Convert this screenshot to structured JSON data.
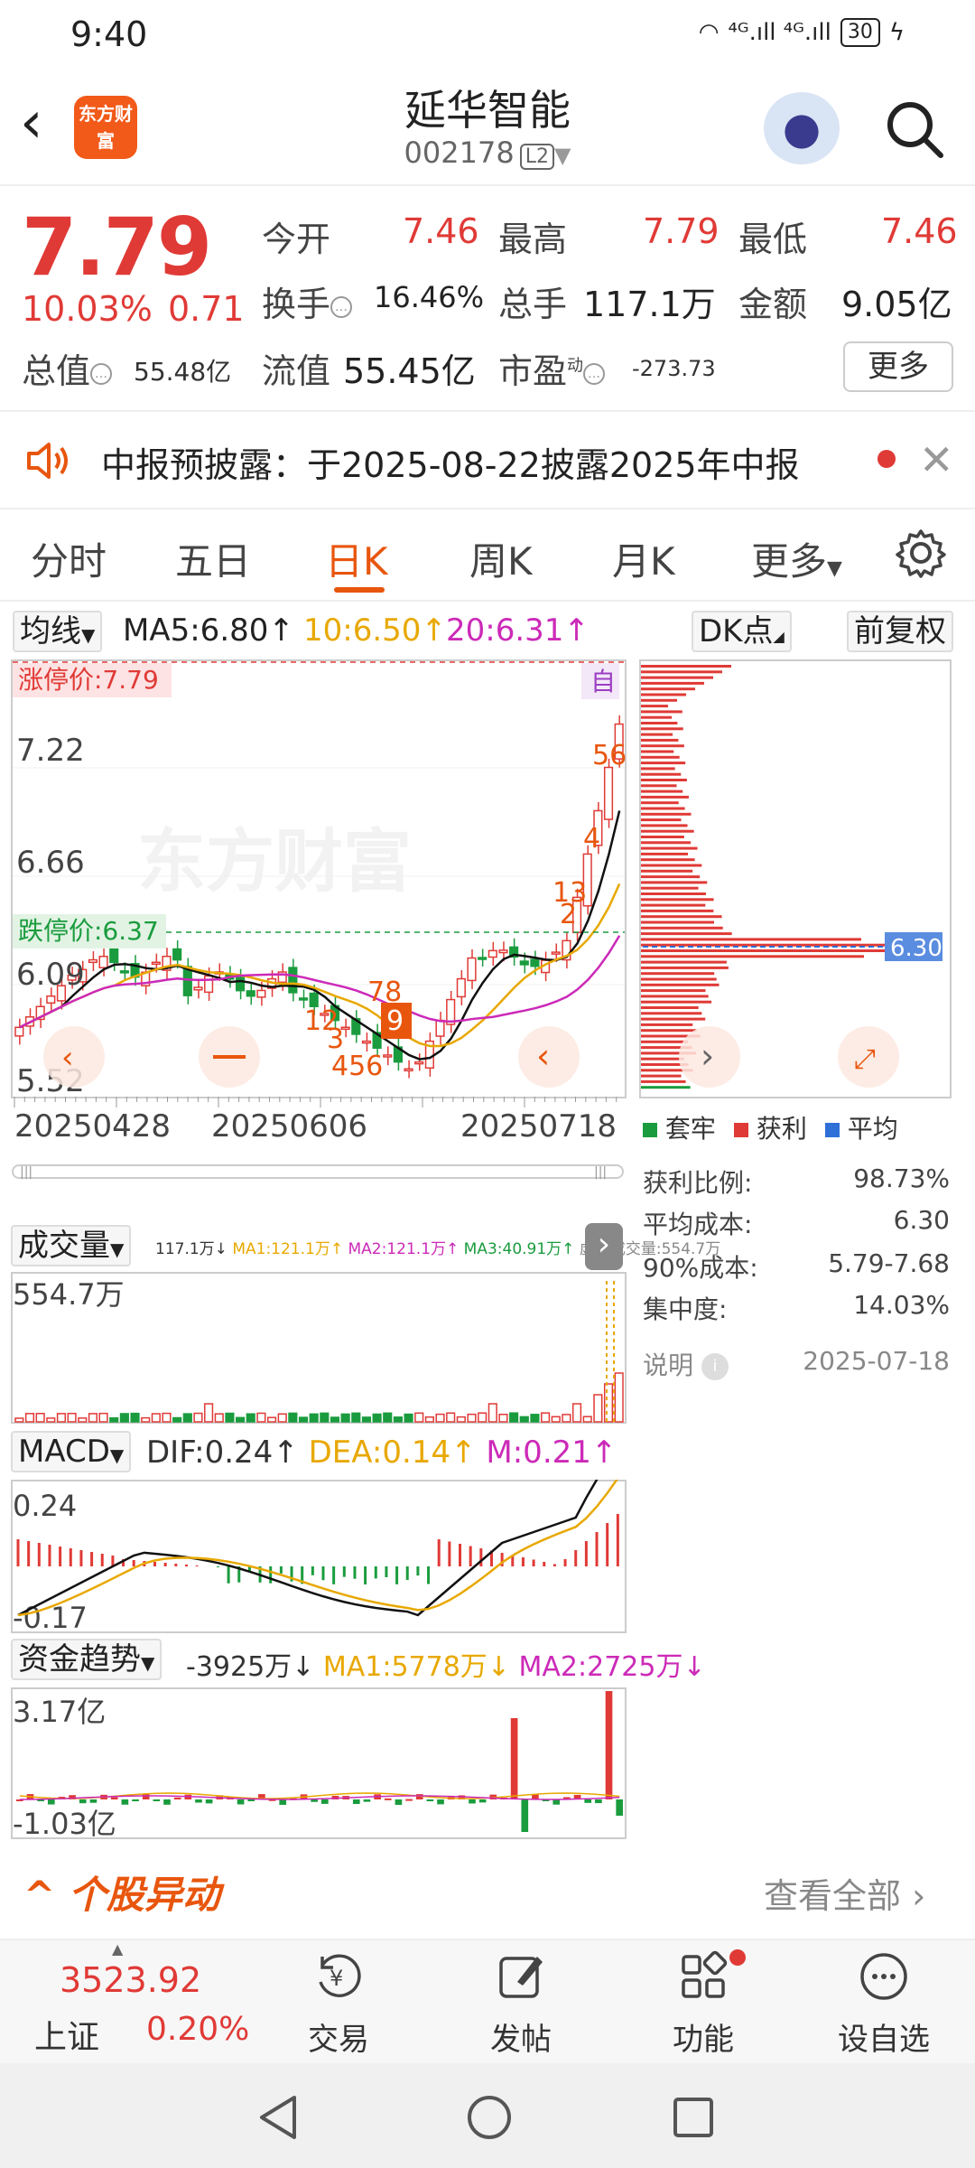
{
  "status": {
    "time": "9:40",
    "signal": "⁴ᴳ.ıll ⁴ᴳ.ıll",
    "battery": "30"
  },
  "header": {
    "brand": "东方财富",
    "stock_name": "延华智能",
    "stock_code": "002178",
    "level_badge": "L2"
  },
  "quote": {
    "price": "7.79",
    "change_pct": "10.03%",
    "change_amt": "0.71",
    "open_label": "今开",
    "open": "7.46",
    "high_label": "最高",
    "high": "7.79",
    "low_label": "最低",
    "low": "7.46",
    "turnover_label": "换手",
    "turnover": "16.46%",
    "volume_label": "总手",
    "volume": "117.1万",
    "amount_label": "金额",
    "amount": "9.05亿",
    "mktcap_label": "总值",
    "mktcap": "55.48亿",
    "float_label": "流值",
    "float": "55.45亿",
    "pe_label": "市盈",
    "pe_sup": "动",
    "pe": "-273.73",
    "more": "更多"
  },
  "notice": {
    "text": "中报预披露：于2025-08-22披露2025年中报"
  },
  "tabs": [
    "分时",
    "五日",
    "日K",
    "周K",
    "月K",
    "更多"
  ],
  "ma_row": {
    "selector": "均线",
    "ma5": "MA5:6.80↑",
    "ma10": "10:6.50↑",
    "ma20": "20:6.31↑",
    "dk": "DK点",
    "adj": "前复权"
  },
  "kchart": {
    "limit_up": "涨停价:7.79",
    "limit_down": "跌停价:6.37",
    "y_ticks": [
      "7.22",
      "6.66",
      "6.09",
      "5.52"
    ],
    "x_ticks": [
      "20250428",
      "20250606",
      "20250718"
    ],
    "watermark": "东方财富",
    "auto_label": "自",
    "marker_labels": [
      "12",
      "3",
      "456",
      "78",
      "9",
      "13",
      "2",
      "4",
      "56"
    ]
  },
  "chip": {
    "avg_label": "6.30",
    "legend": [
      "套牢",
      "获利",
      "平均"
    ],
    "stats": [
      {
        "label": "获利比例:",
        "value": "98.73%"
      },
      {
        "label": "平均成本:",
        "value": "6.30"
      },
      {
        "label": "90%成本:",
        "value": "5.79-7.68"
      },
      {
        "label": "集中度:",
        "value": "14.03%"
      }
    ],
    "note_label": "说明",
    "date": "2025-07-18"
  },
  "volume": {
    "selector": "成交量",
    "values": "117.1万↓",
    "ma1": "MA1:121.1万↑",
    "ma2": "MA2:121.1万↑",
    "ma3": "MA3:40.91万↑",
    "virtual": "虚拟成交量:554.7万",
    "top": "554.7万"
  },
  "macd": {
    "selector": "MACD",
    "dif": "DIF:0.24↑",
    "dea": "DEA:0.14↑",
    "m": "M:0.21↑",
    "top": "0.24",
    "bottom": "-0.17"
  },
  "fund": {
    "selector": "资金趋势",
    "value": "-3925万↓",
    "ma1": "MA1:5778万↓",
    "ma2": "MA2:2725万↓",
    "top": "3.17亿",
    "bottom": "-1.03亿"
  },
  "stock_move": {
    "title": "个股异动",
    "view_all": "查看全部"
  },
  "bottom_nav": {
    "index_value": "3523.92",
    "index_name": "上证",
    "index_pct": "0.20%",
    "items": [
      "交易",
      "发帖",
      "功能",
      "设自选"
    ]
  },
  "colors": {
    "up": "#e03a36",
    "down": "#1a9c3e",
    "accent": "#e8560e",
    "ma10": "#e8a800",
    "ma20": "#cc2ab8"
  }
}
